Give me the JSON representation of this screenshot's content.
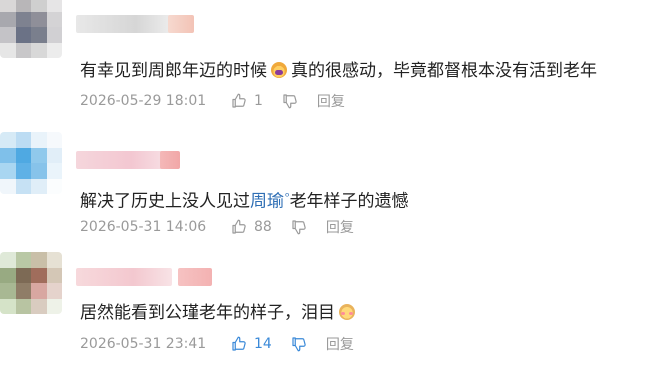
{
  "colors": {
    "text": "#222222",
    "meta": "#9a9a9a",
    "mention": "#2f6fb5",
    "liked": "#3a89d8"
  },
  "comments": [
    {
      "text_before": "有幸见到周郎年迈的时候",
      "emoji": "crying-face-icon",
      "text_after": "真的很感动，毕竟都督根本没有活到老年",
      "timestamp": "2026-05-29 18:01",
      "likes": "1",
      "reply_label": "回复"
    },
    {
      "text_before": "解决了历史上没人见过",
      "mention": "周瑜",
      "mention_mark": "ᵒ",
      "text_after": "老年样子的遗憾",
      "timestamp": "2026-05-31 14:06",
      "likes": "88",
      "reply_label": "回复"
    },
    {
      "text_before": "居然能看到公瑾老年的样子，泪目",
      "emoji": "blushing-face-icon",
      "timestamp": "2026-05-31 23:41",
      "likes": "14",
      "reply_label": "回复",
      "liked": true
    }
  ]
}
